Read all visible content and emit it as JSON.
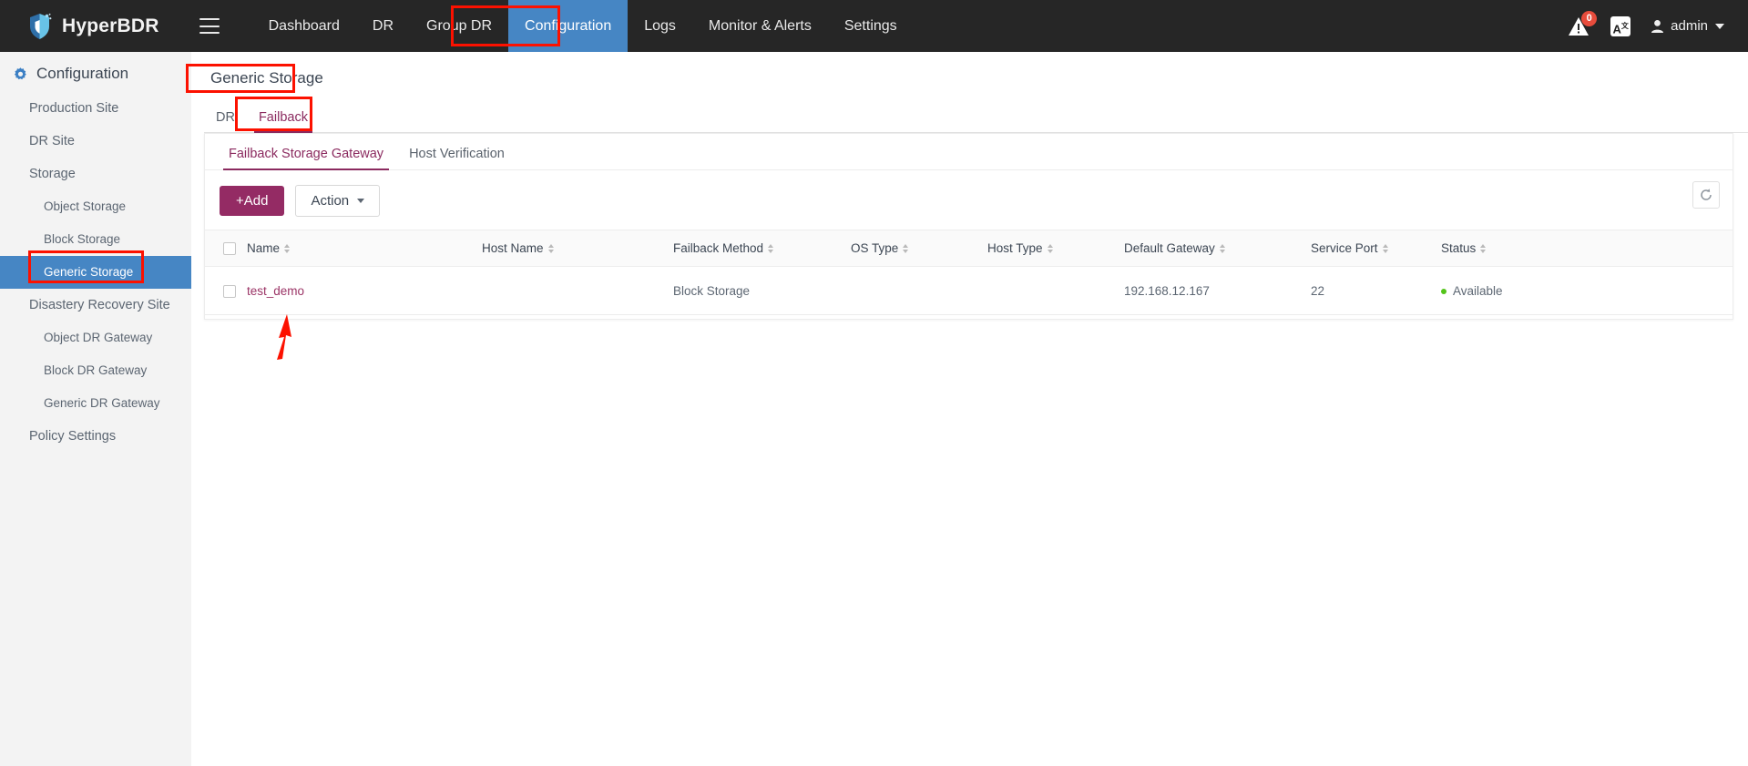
{
  "app": {
    "brand": "HyperBDR",
    "logo_icon": "shield-logo-icon",
    "menu_icon": "hamburger-menu-icon"
  },
  "topnav": {
    "items": [
      {
        "label": "Dashboard",
        "active": false
      },
      {
        "label": "DR",
        "active": false
      },
      {
        "label": "Group DR",
        "active": false
      },
      {
        "label": "Configuration",
        "active": true
      },
      {
        "label": "Logs",
        "active": false
      },
      {
        "label": "Monitor & Alerts",
        "active": false
      },
      {
        "label": "Settings",
        "active": false
      }
    ],
    "active_bg": "#4686c4",
    "alert_icon": "alert-warning-icon",
    "alert_count": "0",
    "lang_icon": "language-translate-icon",
    "lang_label": "A",
    "user_icon": "user-avatar-icon",
    "user_name": "admin",
    "caret_icon": "chevron-down-icon"
  },
  "sidebar": {
    "header_icon": "gear-config-icon",
    "header": "Configuration",
    "items": [
      {
        "label": "Production Site",
        "level": 1,
        "active": false
      },
      {
        "label": "DR Site",
        "level": 1,
        "active": false
      },
      {
        "label": "Storage",
        "level": 1,
        "active": false
      },
      {
        "label": "Object Storage",
        "level": 2,
        "active": false
      },
      {
        "label": "Block Storage",
        "level": 2,
        "active": false
      },
      {
        "label": "Generic Storage",
        "level": 2,
        "active": true
      },
      {
        "label": "Disastery Recovery Site",
        "level": 1,
        "active": false
      },
      {
        "label": "Object DR Gateway",
        "level": 2,
        "active": false
      },
      {
        "label": "Block DR Gateway",
        "level": 2,
        "active": false
      },
      {
        "label": "Generic DR Gateway",
        "level": 2,
        "active": false
      },
      {
        "label": "Policy Settings",
        "level": 1,
        "active": false
      }
    ]
  },
  "main": {
    "page_title": "Generic Storage",
    "outer_tabs": [
      {
        "label": "DR",
        "active": false
      },
      {
        "label": "Failback",
        "active": true
      }
    ],
    "inner_tabs": [
      {
        "label": "Failback Storage Gateway",
        "active": true
      },
      {
        "label": "Host Verification",
        "active": false
      }
    ],
    "toolbar": {
      "add_label": "+Add",
      "action_label": "Action",
      "action_caret_icon": "chevron-down-icon",
      "refresh_icon": "refresh-icon"
    },
    "table": {
      "select_all_icon": "checkbox-unchecked-icon",
      "sort_icon": "sort-arrows-icon",
      "columns": [
        "Name",
        "Host Name",
        "Failback Method",
        "OS Type",
        "Host Type",
        "Default Gateway",
        "Service Port",
        "Status"
      ],
      "rows": [
        {
          "checkbox_icon": "checkbox-unchecked-icon",
          "name": "test_demo",
          "host_name": "",
          "failback_method": "Block Storage",
          "os_type": "",
          "host_type": "",
          "default_gateway": "192.168.12.167",
          "service_port": "22",
          "status": "Available",
          "status_color": "#53c41a"
        }
      ]
    }
  },
  "annotations": {
    "color": "#fc1100",
    "boxes": [
      "nav-configuration-highlight",
      "page-title-highlight",
      "failback-tab-highlight",
      "sidebar-generic-storage-highlight"
    ],
    "arrow": "pointer-arrow-to-test-demo"
  }
}
